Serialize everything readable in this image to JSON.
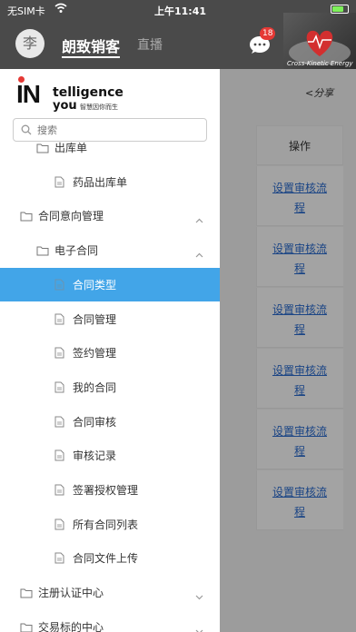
{
  "status_bar": {
    "carrier": "无SIM卡",
    "time": "上午11:41"
  },
  "header": {
    "avatar_text": "李",
    "tabs": [
      {
        "label": "朗致销客",
        "active": true
      },
      {
        "label": "直播",
        "active": false
      }
    ],
    "message_badge": "18",
    "brand_caption": "Cross-Kinetic Energy"
  },
  "background": {
    "share_label": "分享",
    "column_header": "操作",
    "row_action": "设置审核流程",
    "row_action_line1": "设置审核流",
    "row_action_line2": "程"
  },
  "drawer": {
    "logo": {
      "initials": "IN",
      "top": "telligence",
      "bottom": "you",
      "tagline": "智慧因你而生"
    },
    "search_placeholder": "搜索",
    "items": [
      {
        "label": "出库单",
        "level": 2,
        "icon": "folder-icon"
      },
      {
        "label": "药品出库单",
        "level": 3,
        "icon": "document-icon"
      },
      {
        "label": "合同意向管理",
        "level": 1,
        "icon": "folder-icon",
        "expanded": true
      },
      {
        "label": "电子合同",
        "level": 2,
        "icon": "folder-icon",
        "expanded": true
      },
      {
        "label": "合同类型",
        "level": 3,
        "icon": "document-icon",
        "active": true
      },
      {
        "label": "合同管理",
        "level": 3,
        "icon": "document-icon"
      },
      {
        "label": "签约管理",
        "level": 3,
        "icon": "document-icon"
      },
      {
        "label": "我的合同",
        "level": 3,
        "icon": "document-icon"
      },
      {
        "label": "合同审核",
        "level": 3,
        "icon": "document-icon"
      },
      {
        "label": "审核记录",
        "level": 3,
        "icon": "document-icon"
      },
      {
        "label": "签署授权管理",
        "level": 3,
        "icon": "document-icon"
      },
      {
        "label": "所有合同列表",
        "level": 3,
        "icon": "document-icon"
      },
      {
        "label": "合同文件上传",
        "level": 3,
        "icon": "document-icon"
      },
      {
        "label": "注册认证中心",
        "level": 1,
        "icon": "folder-icon",
        "expanded": false
      },
      {
        "label": "交易标的中心",
        "level": 1,
        "icon": "folder-icon",
        "expanded": false
      }
    ]
  },
  "colors": {
    "active": "#42a5e8",
    "link": "#2b6cd1",
    "badge": "#e53935"
  }
}
